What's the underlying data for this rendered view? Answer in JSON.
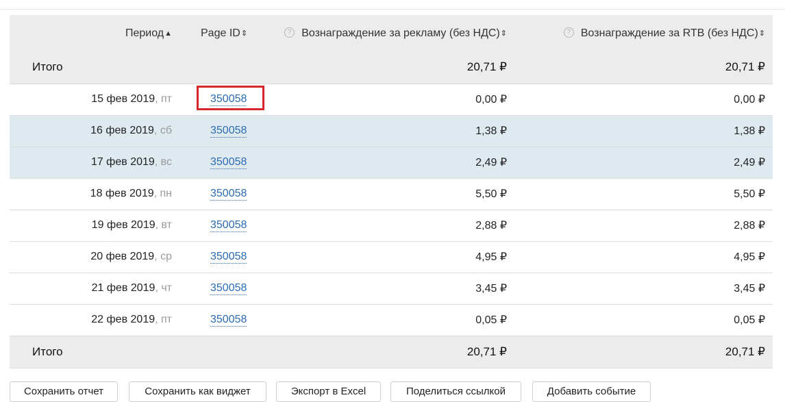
{
  "table": {
    "headers": {
      "period": "Период",
      "period_sort": "▲",
      "page_id": "Page ID",
      "page_id_sort": "⇕",
      "ad_help": "?",
      "ad_reward": "Вознаграждение за рекламу (без НДС)",
      "ad_sort": "⇕",
      "rtb_help": "?",
      "rtb_reward": "Вознаграждение за RTB (без НДС)",
      "rtb_sort": "⇕"
    },
    "total_top": {
      "label": "Итого",
      "ad": "20,71 ₽",
      "rtb": "20,71 ₽"
    },
    "rows": [
      {
        "date": "15 фев 2019",
        "dow": ", пт",
        "page_id": "350058",
        "ad": "0,00 ₽",
        "rtb": "0,00 ₽"
      },
      {
        "date": "16 фев 2019",
        "dow": ", сб",
        "page_id": "350058",
        "ad": "1,38 ₽",
        "rtb": "1,38 ₽"
      },
      {
        "date": "17 фев 2019",
        "dow": ", вс",
        "page_id": "350058",
        "ad": "2,49 ₽",
        "rtb": "2,49 ₽"
      },
      {
        "date": "18 фев 2019",
        "dow": ", пн",
        "page_id": "350058",
        "ad": "5,50 ₽",
        "rtb": "5,50 ₽"
      },
      {
        "date": "19 фев 2019",
        "dow": ", вт",
        "page_id": "350058",
        "ad": "2,88 ₽",
        "rtb": "2,88 ₽"
      },
      {
        "date": "20 фев 2019",
        "dow": ", ср",
        "page_id": "350058",
        "ad": "4,95 ₽",
        "rtb": "4,95 ₽"
      },
      {
        "date": "21 фев 2019",
        "dow": ", чт",
        "page_id": "350058",
        "ad": "3,45 ₽",
        "rtb": "3,45 ₽"
      },
      {
        "date": "22 фев 2019",
        "dow": ", пт",
        "page_id": "350058",
        "ad": "0,05 ₽",
        "rtb": "0,05 ₽"
      }
    ],
    "total_bottom": {
      "label": "Итого",
      "ad": "20,71 ₽",
      "rtb": "20,71 ₽"
    }
  },
  "buttons": {
    "save_report": "Сохранить отчет",
    "save_widget": "Сохранить как виджет",
    "export_excel": "Экспорт в Excel",
    "share_link": "Поделиться ссылкой",
    "add_event": "Добавить событие"
  },
  "colors": {
    "highlight_row": "#deeaef",
    "header_bg": "#ececec",
    "link": "#2a6bb3",
    "annotation_box": "#d6272b"
  }
}
